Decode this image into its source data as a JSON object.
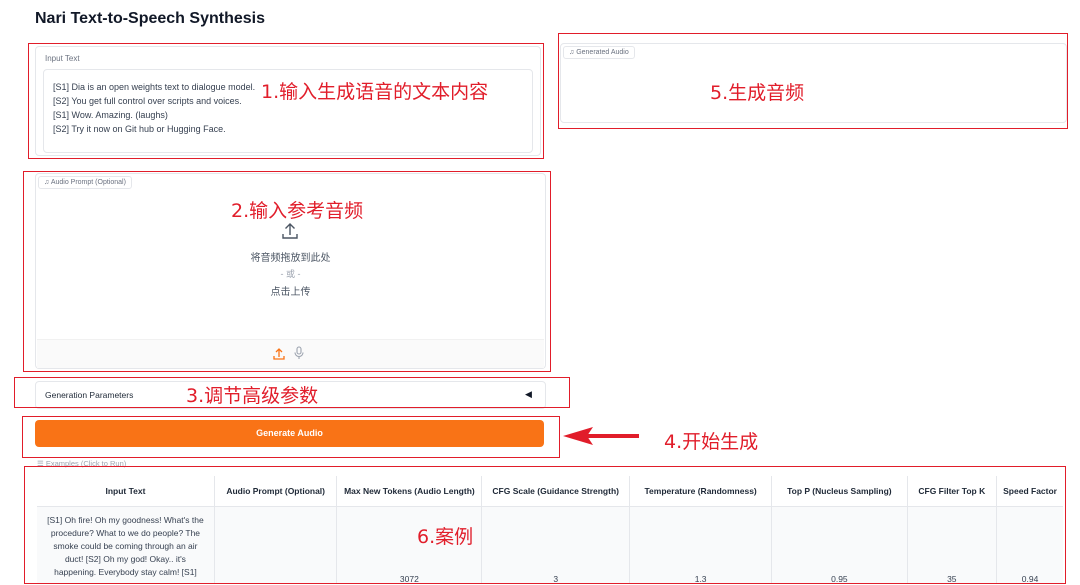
{
  "app": {
    "title": "Nari Text-to-Speech Synthesis"
  },
  "input_text": {
    "label": "Input Text",
    "lines": [
      "[S1] Dia is an open weights text to dialogue model.",
      "[S2] You get full control over scripts and voices.",
      "[S1] Wow. Amazing. (laughs)",
      "[S2] Try it now on Git hub or Hugging Face."
    ]
  },
  "generated_audio": {
    "label": "Generated Audio",
    "icon": "music-note-icon"
  },
  "audio_prompt": {
    "label": "Audio Prompt (Optional)",
    "drop_text": "将音频拖放到此处",
    "or_text": "- 或 -",
    "click_text": "点击上传",
    "icons": [
      "upload-icon",
      "microphone-icon"
    ]
  },
  "generation_parameters": {
    "label": "Generation Parameters",
    "toggle": "◀"
  },
  "generate_button": {
    "label": "Generate Audio"
  },
  "examples": {
    "label": "Examples (Click to Run)",
    "columns": [
      "Input Text",
      "Audio Prompt (Optional)",
      "Max New Tokens (Audio Length)",
      "CFG Scale (Guidance Strength)",
      "Temperature (Randomness)",
      "Top P (Nucleus Sampling)",
      "CFG Filter Top K",
      "Speed Factor"
    ],
    "row": {
      "text": "[S1] Oh fire! Oh my goodness! What's the procedure? What to we do people? The smoke could be coming through an air duct! [S2] Oh my god! Okay.. it's happening. Everybody stay calm! [S1]",
      "max_tokens": "3072",
      "cfg_scale": "3",
      "temperature": "1.3",
      "top_p": "0.95",
      "top_k": "35",
      "speed": "0.94"
    }
  },
  "annotations": {
    "a1": "1.输入生成语音的文本内容",
    "a2": "2.输入参考音频",
    "a3": "3.调节高级参数",
    "a4": "4.开始生成",
    "a5": "5.生成音频",
    "a6": "6.案例"
  },
  "colors": {
    "accent": "#f97316",
    "annotation_red": "#e11d2a"
  }
}
